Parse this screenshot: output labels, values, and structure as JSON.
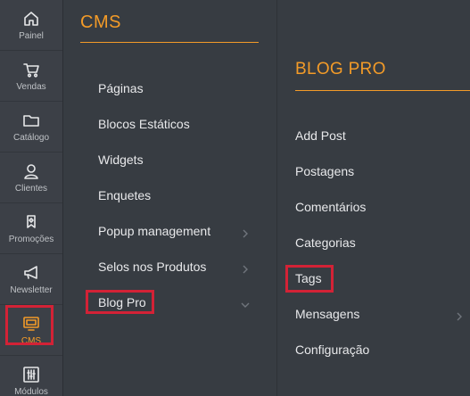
{
  "rail": {
    "items": [
      {
        "label": "Painel",
        "icon": "home-icon"
      },
      {
        "label": "Vendas",
        "icon": "cart-icon"
      },
      {
        "label": "Catálogo",
        "icon": "folder-icon"
      },
      {
        "label": "Clientes",
        "icon": "user-icon"
      },
      {
        "label": "Promoções",
        "icon": "tag-icon"
      },
      {
        "label": "Newsletter",
        "icon": "megaphone-icon"
      },
      {
        "label": "CMS",
        "icon": "monitor-icon"
      },
      {
        "label": "Módulos",
        "icon": "sliders-icon"
      }
    ],
    "active_index": 6,
    "active_color": "#f39b28"
  },
  "cms_menu": {
    "title": "CMS",
    "items": [
      {
        "label": "Páginas"
      },
      {
        "label": "Blocos Estáticos"
      },
      {
        "label": "Widgets"
      },
      {
        "label": "Enquetes"
      },
      {
        "label": "Popup management",
        "chevron": "chevron-right-icon"
      },
      {
        "label": "Selos nos Produtos",
        "chevron": "chevron-right-icon"
      },
      {
        "label": "Blog Pro",
        "chevron": "chevron-down-icon"
      }
    ]
  },
  "blog_menu": {
    "title": "BLOG PRO",
    "items": [
      {
        "label": "Add Post"
      },
      {
        "label": "Postagens"
      },
      {
        "label": "Comentários"
      },
      {
        "label": "Categorias"
      },
      {
        "label": "Tags"
      },
      {
        "label": "Mensagens",
        "chevron": "chevron-right-icon"
      },
      {
        "label": "Configuração"
      }
    ]
  },
  "colors": {
    "accent": "#f39b28",
    "highlight": "#d32236",
    "background": "#373c42"
  }
}
